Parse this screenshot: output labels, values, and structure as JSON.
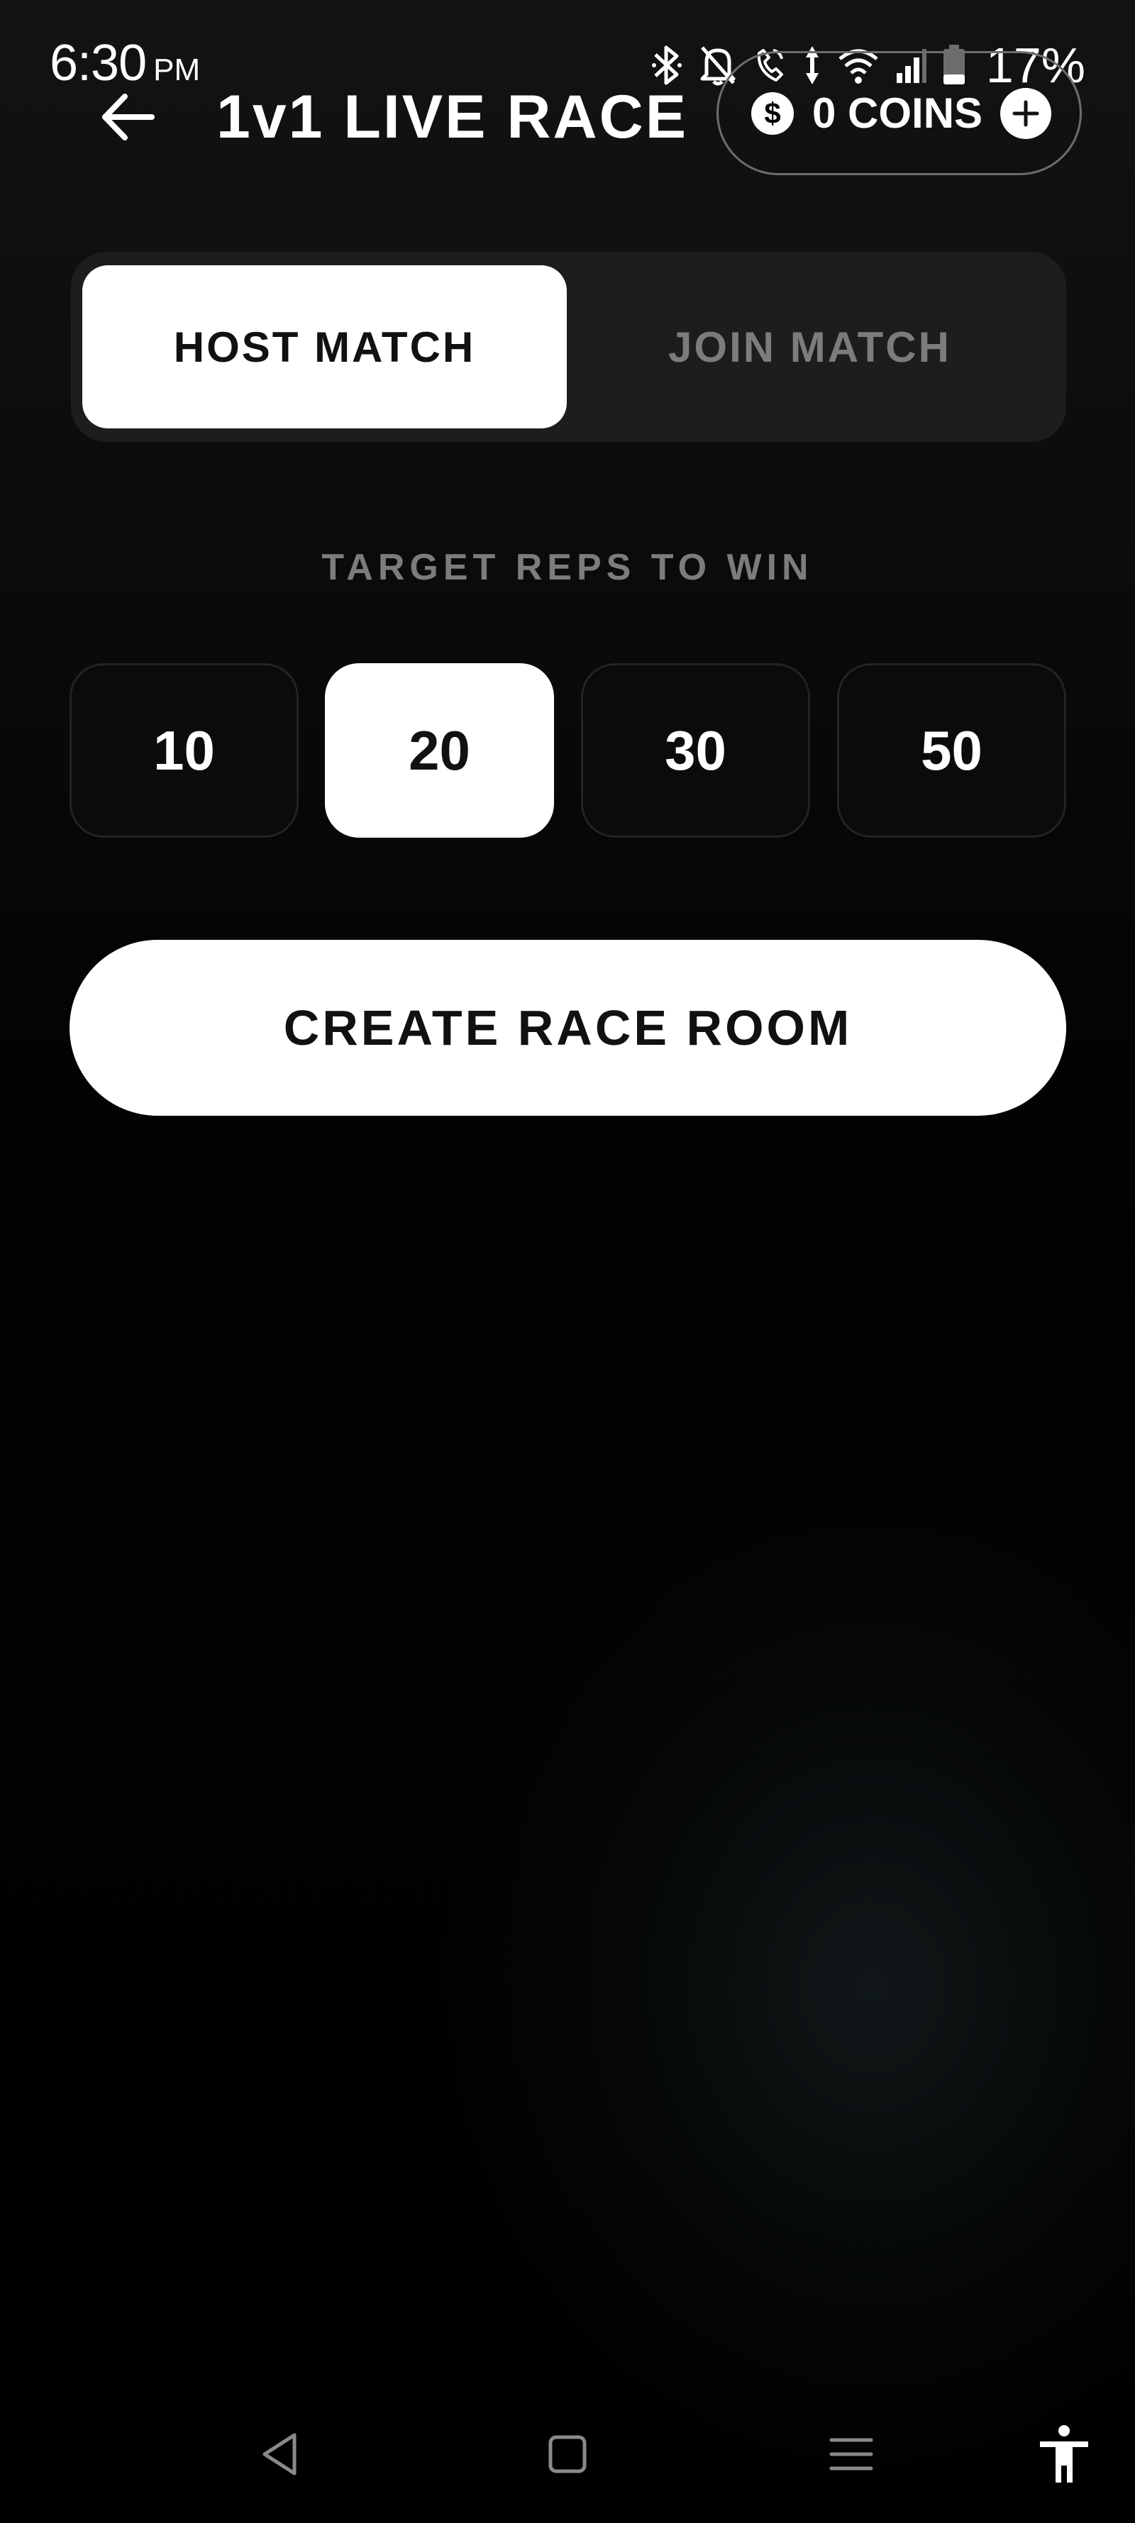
{
  "status_bar": {
    "time": "6:30",
    "ampm": "PM",
    "battery_percent": "17%"
  },
  "header": {
    "title": "1v1 LIVE RACE",
    "coins_label": "0 COINS",
    "coin_symbol": "$"
  },
  "mode_tabs": [
    {
      "label": "HOST MATCH",
      "active": true
    },
    {
      "label": "JOIN MATCH",
      "active": false
    }
  ],
  "target_reps": {
    "label": "TARGET REPS TO WIN",
    "options": [
      "10",
      "20",
      "30",
      "50"
    ],
    "selected": "20"
  },
  "primary_action": {
    "label": "CREATE RACE ROOM"
  },
  "icons": {
    "back": "arrow-left-icon",
    "coin": "dollar-coin-icon",
    "add": "plus-icon",
    "nav_back": "triangle-back-icon",
    "nav_home": "square-home-icon",
    "nav_recents": "lines-recents-icon",
    "accessibility": "accessibility-person-icon"
  },
  "colors": {
    "background": "#000000",
    "surface": "#1d1d1d",
    "accent": "#ffffff",
    "muted_text": "#7c7c7c"
  }
}
